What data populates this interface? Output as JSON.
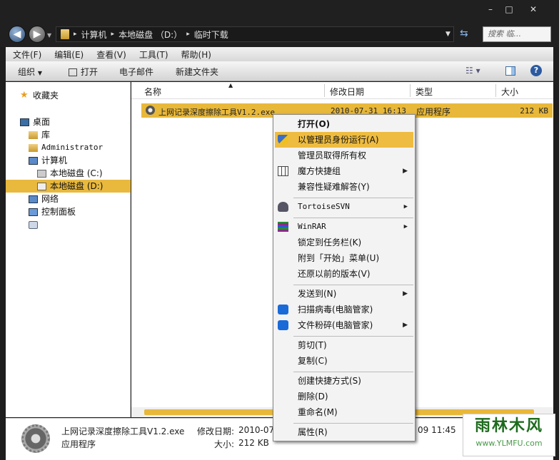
{
  "window": {
    "minimize": "–",
    "maximize": "□",
    "close": "✕"
  },
  "address": {
    "crumbs": [
      "计算机",
      "本地磁盘 （D:）",
      "临时下载"
    ]
  },
  "search": {
    "placeholder": "搜索 临..."
  },
  "menubar": [
    "文件(F)",
    "编辑(E)",
    "查看(V)",
    "工具(T)",
    "帮助(H)"
  ],
  "toolbar": {
    "organize": "组织",
    "open": "打开",
    "email": "电子邮件",
    "new_folder": "新建文件夹"
  },
  "nav": {
    "favorites": "收藏夹",
    "desktop": "桌面",
    "library": "库",
    "admin": "Administrator",
    "computer": "计算机",
    "disk_c": "本地磁盘 (C:)",
    "disk_d": "本地磁盘 (D:)",
    "network": "网络",
    "control_panel": "控制面板"
  },
  "columns": {
    "name": "名称",
    "modified": "修改日期",
    "type": "类型",
    "size": "大小"
  },
  "file": {
    "name": "上网记录深度擦除工具V1.2.exe",
    "modified": "2010-07-31 16:13",
    "type": "应用程序",
    "size": "212 KB"
  },
  "context_menu": {
    "open": "打开(O)",
    "run_as_admin": "以管理员身份运行(A)",
    "take_ownership": "管理员取得所有权",
    "magic_shortcuts": "魔方快捷组",
    "compat": "兼容性疑难解答(Y)",
    "tortoise": "TortoiseSVN",
    "winrar": "WinRAR",
    "pin_taskbar": "锁定到任务栏(K)",
    "pin_start": "附到「开始」菜单(U)",
    "restore": "还原以前的版本(V)",
    "send_to": "发送到(N)",
    "scan": "扫描病毒(电脑管家)",
    "shred": "文件粉碎(电脑管家)",
    "cut": "剪切(T)",
    "copy": "复制(C)",
    "shortcut": "创建快捷方式(S)",
    "delete": "删除(D)",
    "rename": "重命名(M)",
    "properties": "属性(R)"
  },
  "status": {
    "name": "上网记录深度擦除工具V1.2.exe",
    "modified_label": "修改日期:",
    "modified_value": "2010-07-",
    "modified_tail": "09 11:45",
    "type": "应用程序",
    "size_label": "大小:",
    "size_value": "212 KB"
  },
  "watermark": {
    "title": "雨林木风",
    "url": "www.YLMFU.com"
  },
  "colors": {
    "highlight": "#e8b83a",
    "chrome": "#202020"
  }
}
